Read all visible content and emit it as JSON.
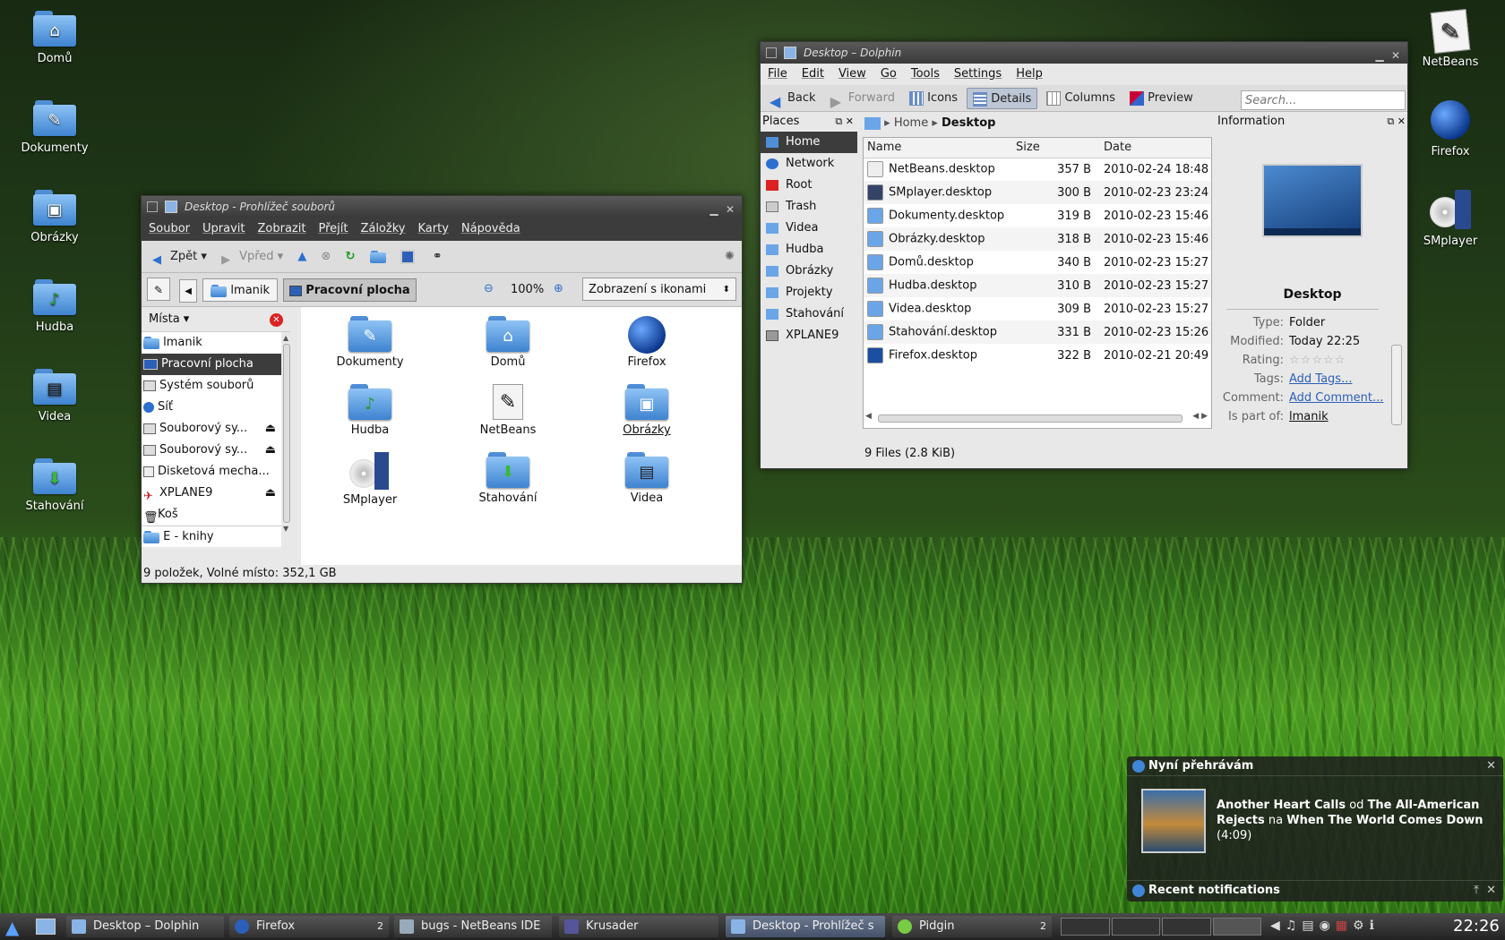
{
  "desktop": {
    "left_icons": [
      {
        "label": "Domů",
        "icon": "home-folder-icon"
      },
      {
        "label": "Dokumenty",
        "icon": "documents-folder-icon"
      },
      {
        "label": "Obrázky",
        "icon": "pictures-folder-icon"
      },
      {
        "label": "Hudba",
        "icon": "music-folder-icon"
      },
      {
        "label": "Videa",
        "icon": "videos-folder-icon"
      },
      {
        "label": "Stahování",
        "icon": "downloads-folder-icon"
      }
    ],
    "right_icons": [
      {
        "label": "NetBeans",
        "icon": "netbeans-icon"
      },
      {
        "label": "Firefox",
        "icon": "firefox-icon"
      },
      {
        "label": "SMplayer",
        "icon": "smplayer-icon"
      }
    ]
  },
  "dolphin": {
    "title": "Desktop – Dolphin",
    "menu": [
      "File",
      "Edit",
      "View",
      "Go",
      "Tools",
      "Settings",
      "Help"
    ],
    "toolbar": {
      "back": "Back",
      "forward": "Forward",
      "icons": "Icons",
      "details": "Details",
      "columns": "Columns",
      "preview": "Preview",
      "search_placeholder": "Search..."
    },
    "places_title": "Places",
    "places": [
      "Home",
      "Network",
      "Root",
      "Trash",
      "Videa",
      "Hudba",
      "Obrázky",
      "Projekty",
      "Stahování",
      "XPLANE9"
    ],
    "breadcrumb": {
      "home": "Home",
      "current": "Desktop"
    },
    "columns": {
      "name": "Name",
      "size": "Size",
      "date": "Date"
    },
    "files": [
      {
        "name": "NetBeans.desktop",
        "size": "357 B",
        "date": "2010-02-24 18:48"
      },
      {
        "name": "SMplayer.desktop",
        "size": "300 B",
        "date": "2010-02-23 23:24"
      },
      {
        "name": "Dokumenty.desktop",
        "size": "319 B",
        "date": "2010-02-23 15:46"
      },
      {
        "name": "Obrázky.desktop",
        "size": "318 B",
        "date": "2010-02-23 15:46"
      },
      {
        "name": "Domů.desktop",
        "size": "340 B",
        "date": "2010-02-23 15:27"
      },
      {
        "name": "Hudba.desktop",
        "size": "310 B",
        "date": "2010-02-23 15:27"
      },
      {
        "name": "Videa.desktop",
        "size": "309 B",
        "date": "2010-02-23 15:27"
      },
      {
        "name": "Stahování.desktop",
        "size": "331 B",
        "date": "2010-02-23 15:26"
      },
      {
        "name": "Firefox.desktop",
        "size": "322 B",
        "date": "2010-02-21 20:49"
      }
    ],
    "status": "9 Files (2.8 KiB)",
    "info": {
      "title": "Information",
      "name": "Desktop",
      "type_label": "Type:",
      "type": "Folder",
      "modified_label": "Modified:",
      "modified": "Today 22:25",
      "rating_label": "Rating:",
      "tags_label": "Tags:",
      "tags": "Add Tags...",
      "comment_label": "Comment:",
      "comment": "Add Comment...",
      "partof_label": "Is part of:",
      "partof": "lmanik",
      "rating_stars": 5
    }
  },
  "konq": {
    "title": "Desktop - Prohlížeč souborů",
    "menu": [
      "Soubor",
      "Upravit",
      "Zobrazit",
      "Přejít",
      "Záložky",
      "Karty",
      "Nápověda"
    ],
    "toolbar": {
      "back": "Zpět",
      "forward": "Vpřed"
    },
    "crumbs": [
      "lmanik",
      "Pracovní plocha"
    ],
    "zoom": "100%",
    "view_mode": "Zobrazení s ikonami",
    "places_title": "Místa",
    "places": [
      "lmanik",
      "Pracovní plocha",
      "Systém souborů",
      "Síť",
      "Souborový sy...",
      "Souborový sy...",
      "Disketová mecha...",
      "XPLANE9",
      "Koš",
      "E - knihy"
    ],
    "items": [
      "Dokumenty",
      "Domů",
      "Firefox",
      "Hudba",
      "NetBeans",
      "Obrázky",
      "SMplayer",
      "Stahování",
      "Videa"
    ],
    "status": "9 položek, Volné místo: 352,1 GB"
  },
  "notifications": {
    "now_playing_title": "Nyní přehrávám",
    "song": "Another Heart Calls",
    "od": "od",
    "artist": "The All-American Rejects",
    "na": "na",
    "album": "When The World Comes Down",
    "duration": "(4:09)",
    "recent": "Recent notifications"
  },
  "taskbar": {
    "tasks": [
      {
        "label": "Desktop – Dolphin",
        "count": ""
      },
      {
        "label": "Firefox",
        "count": "2"
      },
      {
        "label": "bugs - NetBeans IDE",
        "count": ""
      },
      {
        "label": "Krusader",
        "count": ""
      },
      {
        "label": "Desktop - Prohlížeč s",
        "count": ""
      },
      {
        "label": "Pidgin",
        "count": "2"
      }
    ],
    "clock": "22:26"
  },
  "colors": {
    "accent": "#3f86d6",
    "titlebar": "#3a3a3a",
    "selection": "#3c3c3c"
  }
}
